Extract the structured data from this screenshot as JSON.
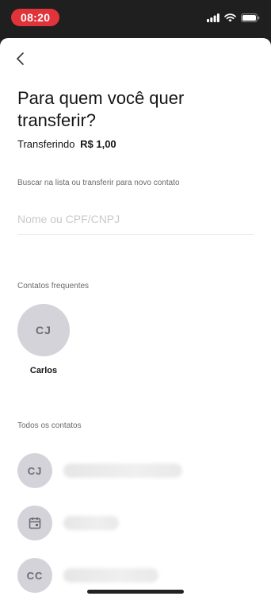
{
  "status_bar": {
    "time": "08:20"
  },
  "header": {
    "title": "Para quem você quer transferir?",
    "subtitle_prefix": "Transferindo",
    "amount": "R$ 1,00"
  },
  "search": {
    "help_text": "Buscar na lista ou transferir para novo contato",
    "placeholder": "Nome ou CPF/CNPJ",
    "value": ""
  },
  "frequent": {
    "label": "Contatos frequentes",
    "contacts": [
      {
        "initials": "CJ",
        "name": "Carlos"
      }
    ]
  },
  "all_contacts": {
    "label": "Todos os contatos",
    "items": [
      {
        "initials": "CJ",
        "icon": null
      },
      {
        "initials": "",
        "icon": "calendar-icon"
      },
      {
        "initials": "CC",
        "icon": null
      }
    ]
  },
  "colors": {
    "time_pill": "#e0343a",
    "avatar_bg": "#d4d3da",
    "avatar_text": "#6c6b75",
    "text_primary": "#151515",
    "text_secondary": "#6a6a6a",
    "placeholder": "#c9c9c9"
  }
}
